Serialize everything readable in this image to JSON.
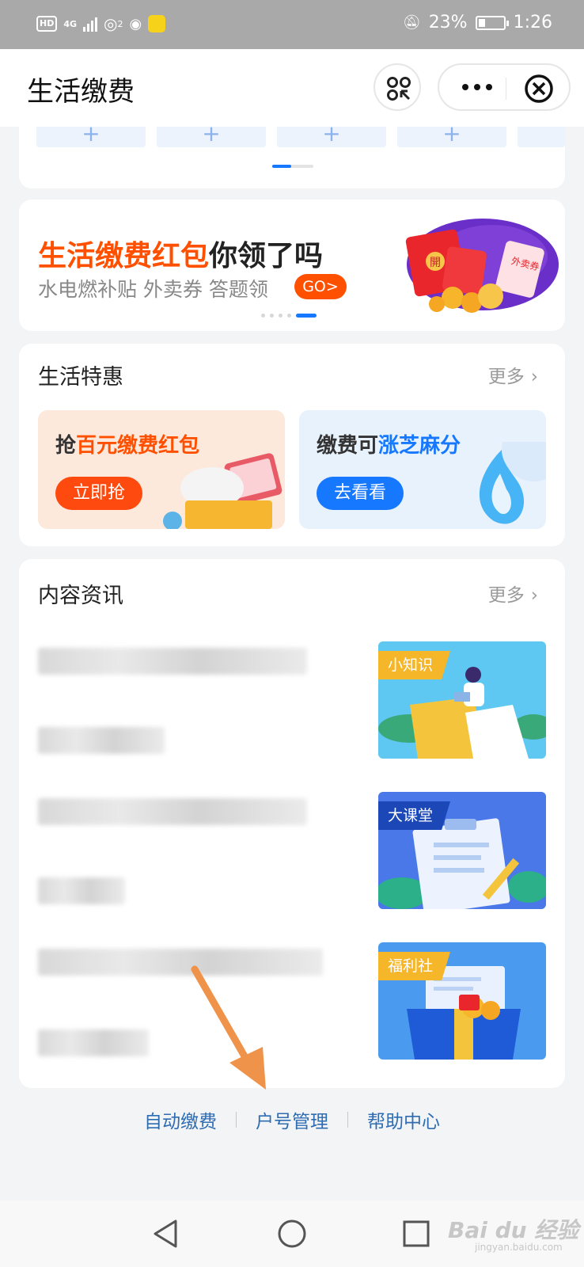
{
  "status_bar": {
    "hd": "HD",
    "net": "4G",
    "badge": "2",
    "battery": "23%",
    "time": "1:26"
  },
  "header": {
    "title": "生活缴费"
  },
  "banner": {
    "title_highlight": "生活缴费红包",
    "title_rest": "你领了吗",
    "subtitle": "水电燃补贴 外卖券 答题领",
    "go": "GO>",
    "art_text_1": "開",
    "art_text_2": "外卖券"
  },
  "special": {
    "title": "生活特惠",
    "more": "更多",
    "left": {
      "title_a": "抢",
      "title_b": "百元缴费红包",
      "button": "立即抢"
    },
    "right": {
      "title_a": "缴费可",
      "title_b": "涨芝麻分",
      "button": "去看看"
    }
  },
  "news": {
    "title": "内容资讯",
    "more": "更多",
    "items": [
      {
        "tag": "小知识"
      },
      {
        "tag": "大课堂"
      },
      {
        "tag": "福利社"
      }
    ]
  },
  "footer": {
    "links": [
      "自动缴费",
      "户号管理",
      "帮助中心"
    ]
  },
  "watermark": {
    "main": "Bai du 经验",
    "sub": "jingyan.baidu.com"
  },
  "colors": {
    "accent_orange": "#ff5000",
    "accent_blue": "#1677ff",
    "link_blue": "#2f6db3",
    "annotation_arrow": "#f0934a"
  }
}
